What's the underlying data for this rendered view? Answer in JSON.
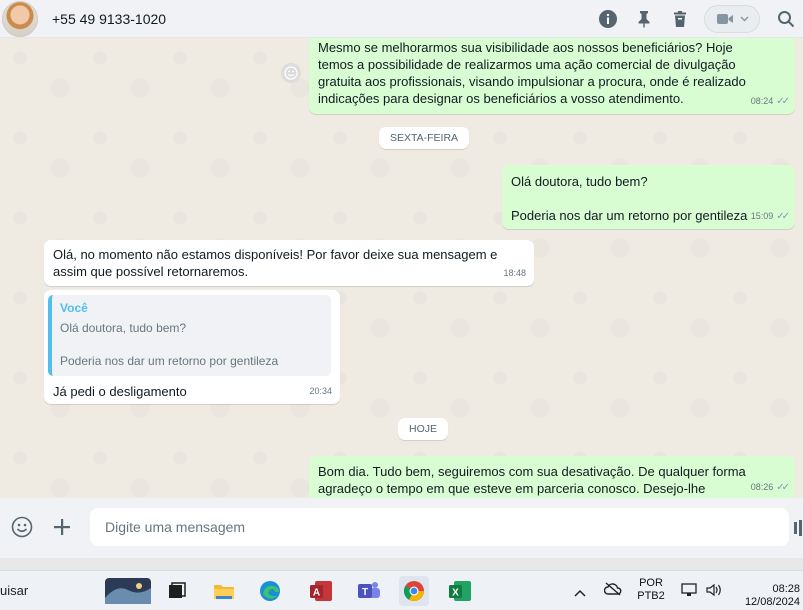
{
  "header": {
    "contact_name": "+55 49 9133-1020",
    "icons": [
      "info-icon",
      "pin-icon",
      "delete-icon",
      "video-call-icon",
      "search-icon"
    ]
  },
  "messages": [
    {
      "direction": "outgoing",
      "text": "Mesmo se melhorarmos sua visibilidade aos nossos beneficiários? Hoje temos a possibilidade de realizarmos uma ação comercial de divulgação gratuita aos profissionais, visando impulsionar a procura, onde é realizado indicações para designar os beneficiários a vosso atendimento.",
      "time": "08:24",
      "status": "sent"
    },
    {
      "type": "date",
      "label": "SEXTA-FEIRA"
    },
    {
      "direction": "outgoing",
      "line1": "Olá doutora, tudo bem?",
      "line2": "Poderia nos dar um retorno por gentileza",
      "time": "15:09",
      "status": "sent"
    },
    {
      "direction": "incoming",
      "text": "Olá, no momento não estamos disponíveis! Por favor deixe sua mensagem e assim que possível retornaremos.",
      "time": "18:48"
    },
    {
      "direction": "incoming",
      "quote": {
        "author": "Você",
        "line1": "Olá doutora, tudo bem?",
        "line2": "Poderia nos dar um retorno por gentileza"
      },
      "text": "Já pedi o desligamento",
      "time": "20:34"
    },
    {
      "type": "date",
      "label": "HOJE"
    },
    {
      "direction": "outgoing",
      "text": "Bom dia. Tudo bem, seguiremos com sua desativação. De qualquer forma agradeço o tempo em que esteve em parceria conosco. Desejo-lhe sucesso! 😊",
      "time": "08:26",
      "status": "sent"
    }
  ],
  "compose": {
    "placeholder": "Digite uma mensagem"
  },
  "taskbar": {
    "search_fragment": "uisar",
    "apps": [
      "widgets-icon",
      "task-view-icon",
      "file-explorer-icon",
      "edge-icon",
      "access-icon",
      "teams-icon",
      "chrome-icon",
      "excel-icon"
    ],
    "language_line1": "POR",
    "language_line2": "PTB2",
    "time": "08:28",
    "date": "12/08/2024"
  },
  "colors": {
    "outgoing_bubble": "#d9fdd3",
    "incoming_bubble": "#ffffff",
    "chat_background": "#efeae2",
    "quote_accent": "#53bdeb"
  }
}
